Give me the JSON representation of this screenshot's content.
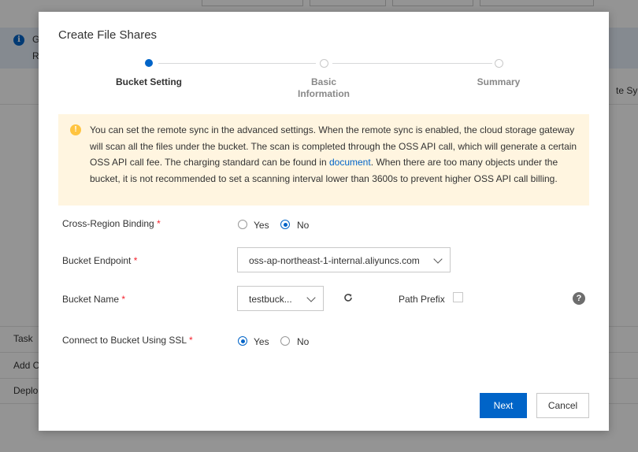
{
  "background": {
    "banner_line1": "G",
    "banner_line2": "R",
    "right_text": "te Syn",
    "rows": [
      "Task",
      "Add C",
      "Deplo"
    ]
  },
  "modal": {
    "title": "Create File Shares",
    "steps": [
      {
        "label_line1": "Bucket Setting",
        "label_line2": "",
        "state": "active"
      },
      {
        "label_line1": "Basic",
        "label_line2": "Information",
        "state": "pending"
      },
      {
        "label_line1": "Summary",
        "label_line2": "",
        "state": "pending"
      }
    ],
    "alert": {
      "text_before_link": "You can set the remote sync in the advanced settings. When the remote sync is enabled, the cloud storage gateway will scan all the files under the bucket. The scan is completed through the OSS API call, which will generate a certain OSS API call fee. The charging standard can be found in ",
      "link_text": "document",
      "text_after_link": ". When there are too many objects under the bucket, it is not recommended to set a scanning interval lower than 3600s to prevent higher OSS API call billing."
    },
    "form": {
      "cross_region_label": "Cross-Region Binding",
      "cross_region_yes": "Yes",
      "cross_region_no": "No",
      "cross_region_value": "No",
      "endpoint_label": "Bucket Endpoint",
      "endpoint_value": "oss-ap-northeast-1-internal.aliyuncs.com",
      "bucket_name_label": "Bucket Name",
      "bucket_name_value": "testbuck...",
      "path_prefix_label": "Path Prefix",
      "path_prefix_checked": false,
      "ssl_label": "Connect to Bucket Using SSL",
      "ssl_yes": "Yes",
      "ssl_no": "No",
      "ssl_value": "Yes",
      "required_mark": "*"
    },
    "buttons": {
      "next": "Next",
      "cancel": "Cancel"
    }
  },
  "colors": {
    "primary": "#0064c8",
    "alert_bg": "#fff5e0",
    "warning_icon": "#ffc440",
    "required": "#f5222d"
  },
  "icons": {
    "info": "info-icon",
    "warning": "warning-icon",
    "refresh": "refresh-icon",
    "help": "help-icon",
    "chevron": "chevron-down-icon"
  }
}
